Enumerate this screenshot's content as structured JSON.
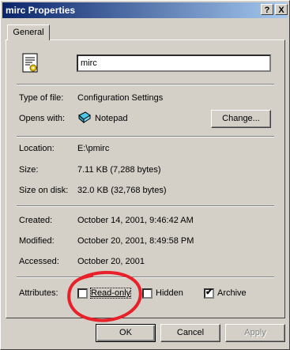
{
  "window": {
    "title": "mirc Properties",
    "help_glyph": "?",
    "close_glyph": "X"
  },
  "tabs": [
    {
      "label": "General"
    }
  ],
  "file": {
    "name": "mirc",
    "icon": "configuration-settings-icon"
  },
  "info": {
    "type_label": "Type of file:",
    "type_value": "Configuration Settings",
    "opens_label": "Opens with:",
    "opens_value": "Notepad",
    "opens_icon": "notepad-icon",
    "change_button": "Change...",
    "location_label": "Location:",
    "location_value": "E:\\pmirc",
    "size_label": "Size:",
    "size_value": "7.11 KB (7,288 bytes)",
    "size_on_disk_label": "Size on disk:",
    "size_on_disk_value": "32.0 KB (32,768 bytes)",
    "created_label": "Created:",
    "created_value": "October 14, 2001, 9:46:42 AM",
    "modified_label": "Modified:",
    "modified_value": "October 20, 2001, 8:49:58 PM",
    "accessed_label": "Accessed:",
    "accessed_value": "October 20, 2001"
  },
  "attributes": {
    "label": "Attributes:",
    "read_only": {
      "label": "Read-only",
      "checked": false
    },
    "hidden": {
      "label": "Hidden",
      "checked": false
    },
    "archive": {
      "label": "Archive",
      "checked": true
    }
  },
  "buttons": {
    "ok": "OK",
    "cancel": "Cancel",
    "apply": "Apply"
  },
  "colors": {
    "title_start": "#0a246a",
    "title_end": "#a6caf0",
    "face": "#d4d0c8",
    "annotation": "#e8202a"
  }
}
